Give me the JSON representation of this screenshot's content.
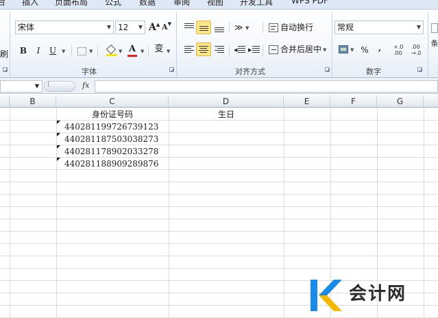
{
  "ribbon": {
    "tabs": [
      "插入",
      "页面布局",
      "公式",
      "数据",
      "审阅",
      "视图",
      "开发工具",
      "WPS PDF"
    ],
    "partial_tab_left": "台",
    "font_name": "宋体",
    "font_size": "12",
    "grow_font": "A",
    "shrink_font": "A",
    "bold": "B",
    "italic": "I",
    "underline": "U",
    "font_color_glyph": "A",
    "phonetic_glyph": "变",
    "wrap_text_label": "自动换行",
    "merge_center_label": "合并后居中",
    "number_format": "常规",
    "percent": "%",
    "comma": ",",
    "inc_decimal": "+.0",
    "inc_decimal_2": ".00",
    "dec_decimal": ".00",
    "dec_decimal_2": "→.0",
    "clipboard_fragment": "刷",
    "styles_fragment": "条",
    "groups": {
      "font": "字体",
      "alignment": "对齐方式",
      "number": "数字"
    }
  },
  "formula_bar": {
    "name_box_value": "",
    "fx_label": "fx",
    "formula_value": ""
  },
  "sheet": {
    "columns": [
      "B",
      "C",
      "D",
      "E",
      "F",
      "G"
    ],
    "headers": {
      "C": "身份证号码",
      "D": "生日"
    },
    "id_numbers": [
      "440281199726739123",
      "440281187503038273",
      "440281178902033278",
      "440281188909289876"
    ]
  },
  "watermark": {
    "text": "会计网"
  },
  "colors": {
    "accent_active": "#fde68b",
    "grid": "#dadcdd",
    "logo_blue": "#1a8be6",
    "logo_yellow": "#f5b800"
  }
}
